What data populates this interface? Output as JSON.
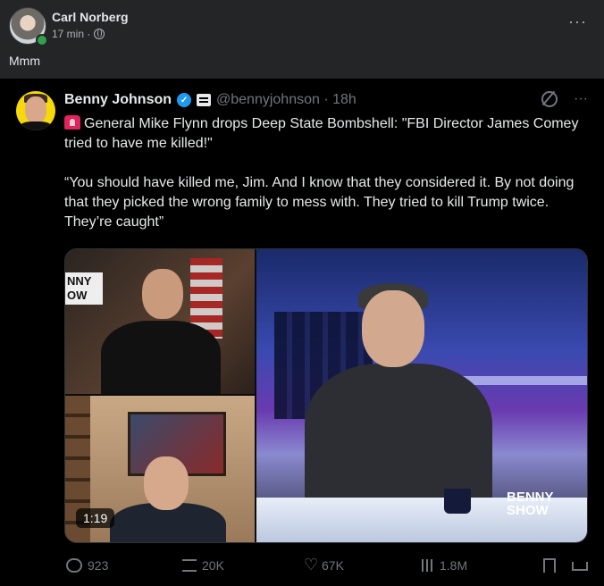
{
  "fb_post": {
    "author": "Carl Norberg",
    "time": "17 min ·",
    "text": "Mmm",
    "more": "···"
  },
  "tweet": {
    "name": "Benny Johnson",
    "handle": "@bennyjohnson · 18h",
    "more": "···",
    "line1": "General Mike Flynn drops Deep State Bombshell: \"FBI Director James Comey tried to have me killed!\"",
    "line2": "“You should have killed me, Jim. And I know that they considered it. By not doing that they picked the wrong family to mess with. They tried to kill Trump twice. They’re caught”",
    "video": {
      "duration": "1:19",
      "logo_tl": "NNY\nOW",
      "logo_right": "BENNY\nSHOW"
    },
    "stats": {
      "replies": "923",
      "reposts": "20K",
      "likes": "67K",
      "views": "1.8M"
    }
  },
  "icons": {
    "audience": "globe-icon",
    "verified": "verified-badge-icon",
    "affiliation": "organization-icon",
    "grok": "grok-icon",
    "siren": "siren-emoji",
    "reply": "reply-icon",
    "repost": "repost-icon",
    "like": "like-icon",
    "views": "views-icon",
    "bookmark": "bookmark-icon",
    "share": "share-icon"
  },
  "colors": {
    "fb_bg": "#242526",
    "tweet_bg": "#000000",
    "verified": "#1d9bf0",
    "online": "#31a24c",
    "muted": "#71767b"
  }
}
